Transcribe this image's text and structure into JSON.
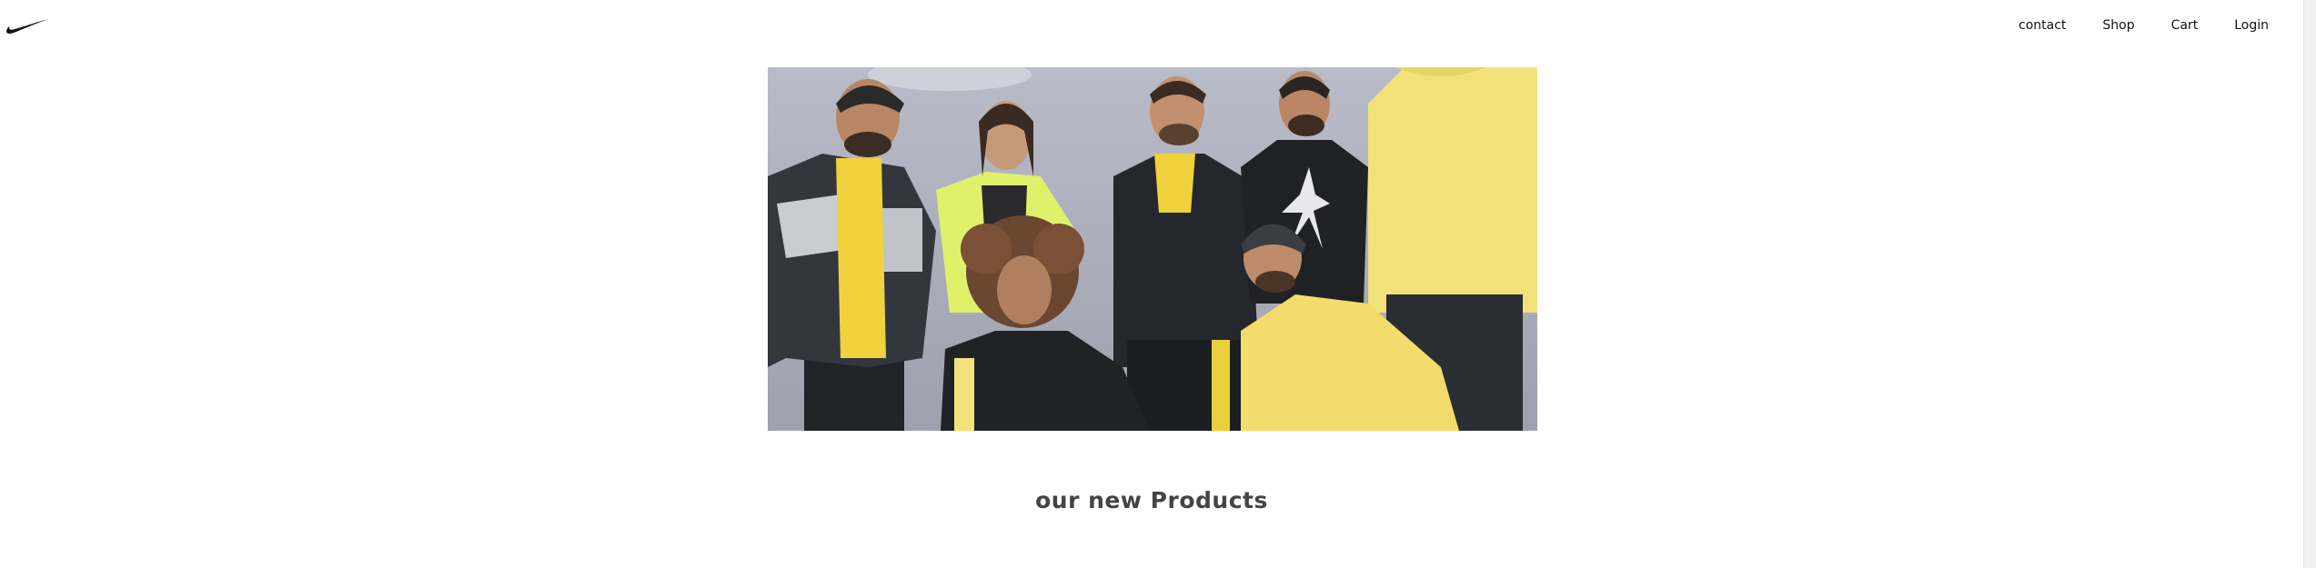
{
  "header": {
    "logo": "nike-swoosh-logo",
    "nav": {
      "contact": "contact",
      "shop": "Shop",
      "cart": "Cart",
      "login": "Login"
    }
  },
  "hero": {
    "image": "group-photo-of-people-in-nike-apparel",
    "colors": {
      "backdrop": "#a9acb8",
      "yellow": "#f2e27a",
      "dark": "#23262b",
      "lime": "#d9ee57"
    }
  },
  "products": {
    "title": "our new Products"
  }
}
